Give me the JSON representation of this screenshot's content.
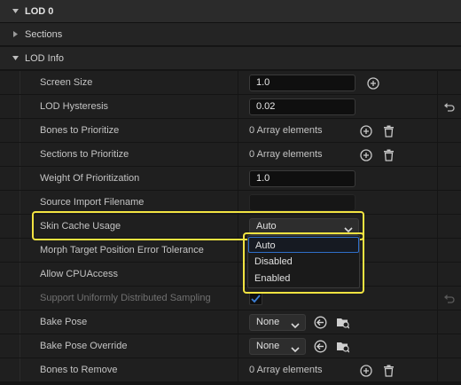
{
  "sections": {
    "lod0": "LOD 0",
    "sections": "Sections",
    "lod_info": "LOD Info"
  },
  "properties": {
    "screen_size": {
      "label": "Screen Size",
      "value": "1.0"
    },
    "lod_hysteresis": {
      "label": "LOD Hysteresis",
      "value": "0.02"
    },
    "bones_to_prioritize": {
      "label": "Bones to Prioritize",
      "value": "0 Array elements"
    },
    "sections_to_prioritize": {
      "label": "Sections to Prioritize",
      "value": "0 Array elements"
    },
    "weight_of_prioritization": {
      "label": "Weight Of Prioritization",
      "value": "1.0"
    },
    "source_import_filename": {
      "label": "Source Import Filename",
      "value": ""
    },
    "skin_cache_usage": {
      "label": "Skin Cache Usage",
      "value": "Auto"
    },
    "morph_target_error": {
      "label": "Morph Target Position Error Tolerance"
    },
    "allow_cpu_access": {
      "label": "Allow CPUAccess"
    },
    "support_uniform_sampling": {
      "label": "Support Uniformly Distributed Sampling"
    },
    "bake_pose": {
      "label": "Bake Pose",
      "value": "None"
    },
    "bake_pose_override": {
      "label": "Bake Pose Override",
      "value": "None"
    },
    "bones_to_remove": {
      "label": "Bones to Remove",
      "value": "0 Array elements"
    }
  },
  "dropdown": {
    "options": [
      "Auto",
      "Disabled",
      "Enabled"
    ],
    "selected": "Auto"
  },
  "icons": {
    "add": "plus-circle-icon",
    "delete": "trash-icon",
    "reset": "reset-arrow-icon",
    "use_selected": "use-selected-arrow-icon",
    "browse": "browse-folder-icon",
    "expand": "triangle-icon"
  },
  "colors": {
    "highlight": "#f2e341",
    "selection_border": "#2f6fc9",
    "checkbox_check": "#3d7fd6"
  }
}
